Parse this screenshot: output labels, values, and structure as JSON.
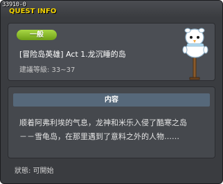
{
  "window": {
    "id": "33910-0",
    "title": "QUEST INFO"
  },
  "header": {
    "category": "一般",
    "quest_name": "[冒险岛英雄] Act 1.龙沉睡的岛",
    "level_requirement": "建議等級: 33~37",
    "mascot_icon": "snowman-signpost-icon"
  },
  "content": {
    "heading": "内容",
    "lines": [
      "顺着阿弗利埃的气息，龙神和米乐入侵了酷寒之岛",
      "－－雪龟岛，在那里遇到了意料之外的人物……"
    ]
  },
  "status": "狀態: 可開始",
  "colors": {
    "title_yellow": "#f2d200",
    "badge_green": "#8cc02a",
    "content_header_blue": "#56687a"
  }
}
